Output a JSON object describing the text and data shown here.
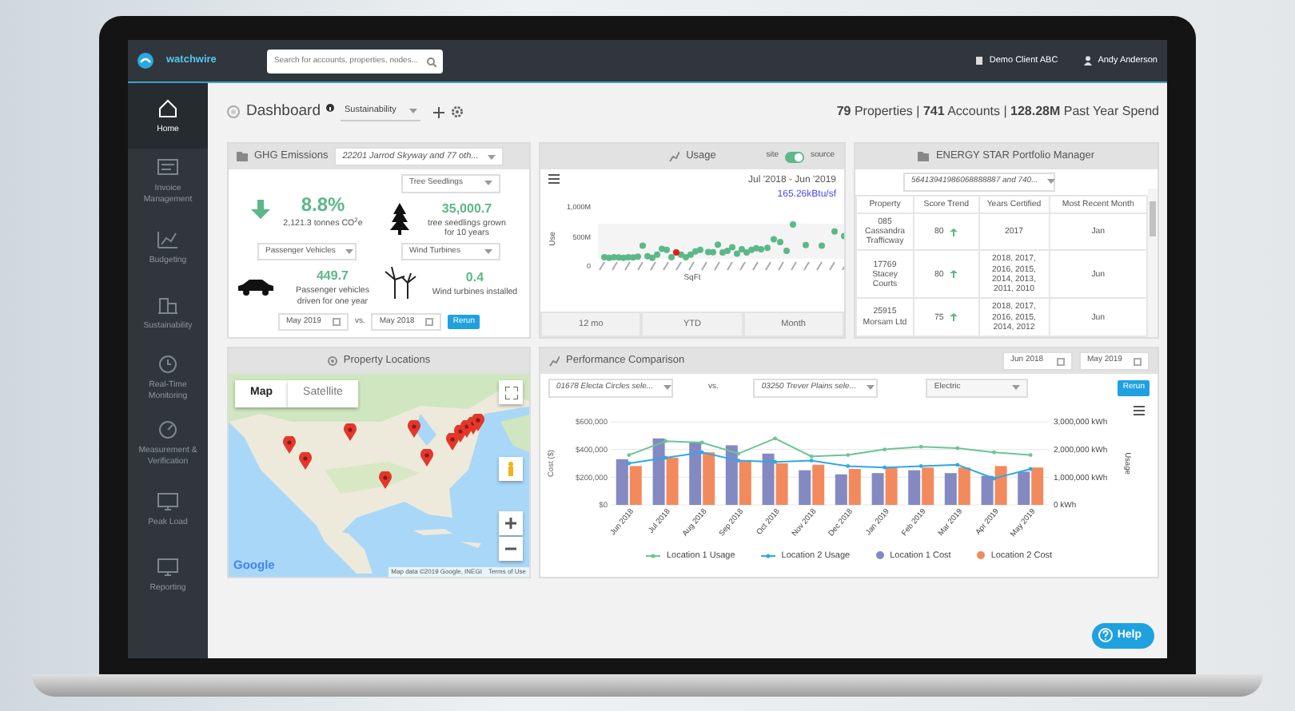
{
  "app": {
    "logo": "watchwire",
    "search": {
      "placeholder": "Search for accounts, properties, nodes..."
    },
    "client": "Demo Client ABC",
    "user": "Andy Anderson"
  },
  "sidebar": {
    "items": [
      {
        "label": "Home",
        "kind": "home",
        "selected": true
      },
      {
        "label": "Invoice Management",
        "kind": "invoice",
        "selected": false
      },
      {
        "label": "Budgeting",
        "kind": "budget",
        "selected": false
      },
      {
        "label": "Sustainability",
        "kind": "building",
        "selected": false
      },
      {
        "label": "Real-Time Monitoring",
        "kind": "clock",
        "selected": false
      },
      {
        "label": "Measurement & Verification",
        "kind": "gauge",
        "selected": false
      },
      {
        "label": "Peak Load",
        "kind": "monitor",
        "selected": false
      },
      {
        "label": "Reporting",
        "kind": "monitor",
        "selected": false
      }
    ]
  },
  "header": {
    "title": "Dashboard",
    "view": "Sustainability",
    "stats": "**79** Properties | **741** Accounts | **128.28M** Past Year Spend"
  },
  "ghg": {
    "title": "GHG Emissions",
    "selection": "22201 Jarrod Skyway and 77 oth...",
    "change": {
      "value": "8.8%",
      "detail": "2,121.3 tonnes CO$^{2}$e",
      "decreased": true
    },
    "equivalents": [
      {
        "kind": "tree",
        "option": "Tree Seedlings",
        "value": "35,000.7",
        "description": "tree seedlings grown for 10 years"
      },
      {
        "kind": "car",
        "option": "Passenger Vehicles",
        "value": "449.7",
        "description": "Passenger vehicles driven for one year"
      },
      {
        "kind": "turbine",
        "option": "Wind Turbines",
        "value": "0.4",
        "description": "Wind turbines installed"
      }
    ],
    "date_from": "May 2019",
    "vs": "vs.",
    "date_to": "May 2018",
    "rerun": "Rerun"
  },
  "usage": {
    "title": "Usage",
    "toggle": {
      "left": "site",
      "right": "source",
      "on": true
    },
    "period": "Jul '2018 - Jun '2019",
    "intensity": "165.26kBtu/sf",
    "ylabel": "Use",
    "yticks": [
      "1,000M",
      "500M",
      "0"
    ],
    "xlabel": "SqFt",
    "ranges": [
      {
        "label": "12 mo",
        "selected": false
      },
      {
        "label": "YTD",
        "selected": false
      },
      {
        "label": "Month",
        "selected": false
      }
    ]
  },
  "energy_star": {
    "title": "ENERGY STAR Portfolio Manager",
    "selection": "56413941986068888887 and 740...",
    "columns": [
      "Property",
      "Score Trend",
      "Years Certified",
      "Most Recent Month"
    ],
    "rows": [
      {
        "property": "085 Cassandra Trafficway",
        "score": "80",
        "trend_up": true,
        "years": "2017",
        "month": "Jan"
      },
      {
        "property": "17769 Stacey Courts",
        "score": "80",
        "trend_up": true,
        "years": "2018, 2017, 2016, 2015, 2014, 2013, 2011, 2010",
        "month": "Jun"
      },
      {
        "property": "25915 Morsam Ltd",
        "score": "75",
        "trend_up": true,
        "years": "2018, 2017, 2016, 2015, 2014, 2012",
        "month": "Jun"
      }
    ]
  },
  "locations": {
    "title": "Property Locations",
    "map_types": [
      {
        "label": "Map",
        "selected": true
      },
      {
        "label": "Satellite",
        "selected": false
      }
    ],
    "logo": "Google",
    "attribution": "Map data ©2019 Google, INEGI",
    "terms": "Terms of Use"
  },
  "performance": {
    "title": "Performance Comparison",
    "date_from": "Jun 2018",
    "date_to": "May 2019",
    "location_1": "01678 Electa Circles sele...",
    "vs": "vs.",
    "location_2": "03250 Trever Plains sele...",
    "commodity": "Electric",
    "rerun": "Rerun",
    "chart_data": {
      "type": "bar",
      "stacked": false,
      "ylabel": "Cost ($)",
      "y2label": "Usage",
      "categories": [
        "Jun 2018",
        "Jul 2018",
        "Aug 2018",
        "Sep 2018",
        "Oct 2018",
        "Nov 2018",
        "Dec 2018",
        "Jan 2019",
        "Feb 2019",
        "Mar 2019",
        "Apr 2019",
        "May 2019"
      ],
      "ylim": [
        0,
        600000
      ],
      "yticks": [
        {
          "value": 0,
          "label": "$0"
        },
        {
          "value": 200000,
          "label": "$200,000"
        },
        {
          "value": 400000,
          "label": "$400,000"
        },
        {
          "value": 600000,
          "label": "$600,000"
        }
      ],
      "y2lim": [
        0,
        3000000
      ],
      "y2ticks": [
        {
          "value": 0,
          "label": "0 kWh"
        },
        {
          "value": 1000000,
          "label": "1,000,000 kWh"
        },
        {
          "value": 2000000,
          "label": "2,000,000 kWh"
        },
        {
          "value": 3000000,
          "label": "3,000,000 kWh"
        }
      ],
      "series": [
        {
          "name": "Location 1 Usage",
          "type": "line",
          "axis": "y2",
          "color": "#6cc495",
          "values": [
            1800000,
            2300000,
            2250000,
            1850000,
            2400000,
            1750000,
            1800000,
            2000000,
            2100000,
            2050000,
            1900000,
            1800000
          ]
        },
        {
          "name": "Location 2 Usage",
          "type": "line",
          "axis": "y2",
          "color": "#2fa8e6",
          "values": [
            1500000,
            1700000,
            1900000,
            1600000,
            1550000,
            1600000,
            1400000,
            1350000,
            1400000,
            1450000,
            950000,
            1300000
          ]
        },
        {
          "name": "Location 1 Cost",
          "type": "bar",
          "axis": "y",
          "color": "#8489c2",
          "values": [
            330000,
            480000,
            450000,
            430000,
            370000,
            250000,
            220000,
            230000,
            250000,
            230000,
            210000,
            240000
          ]
        },
        {
          "name": "Location 2 Cost",
          "type": "bar",
          "axis": "y",
          "color": "#f28a5e",
          "values": [
            280000,
            340000,
            380000,
            320000,
            300000,
            290000,
            260000,
            270000,
            270000,
            270000,
            280000,
            270000
          ]
        }
      ]
    }
  },
  "help": "Help"
}
